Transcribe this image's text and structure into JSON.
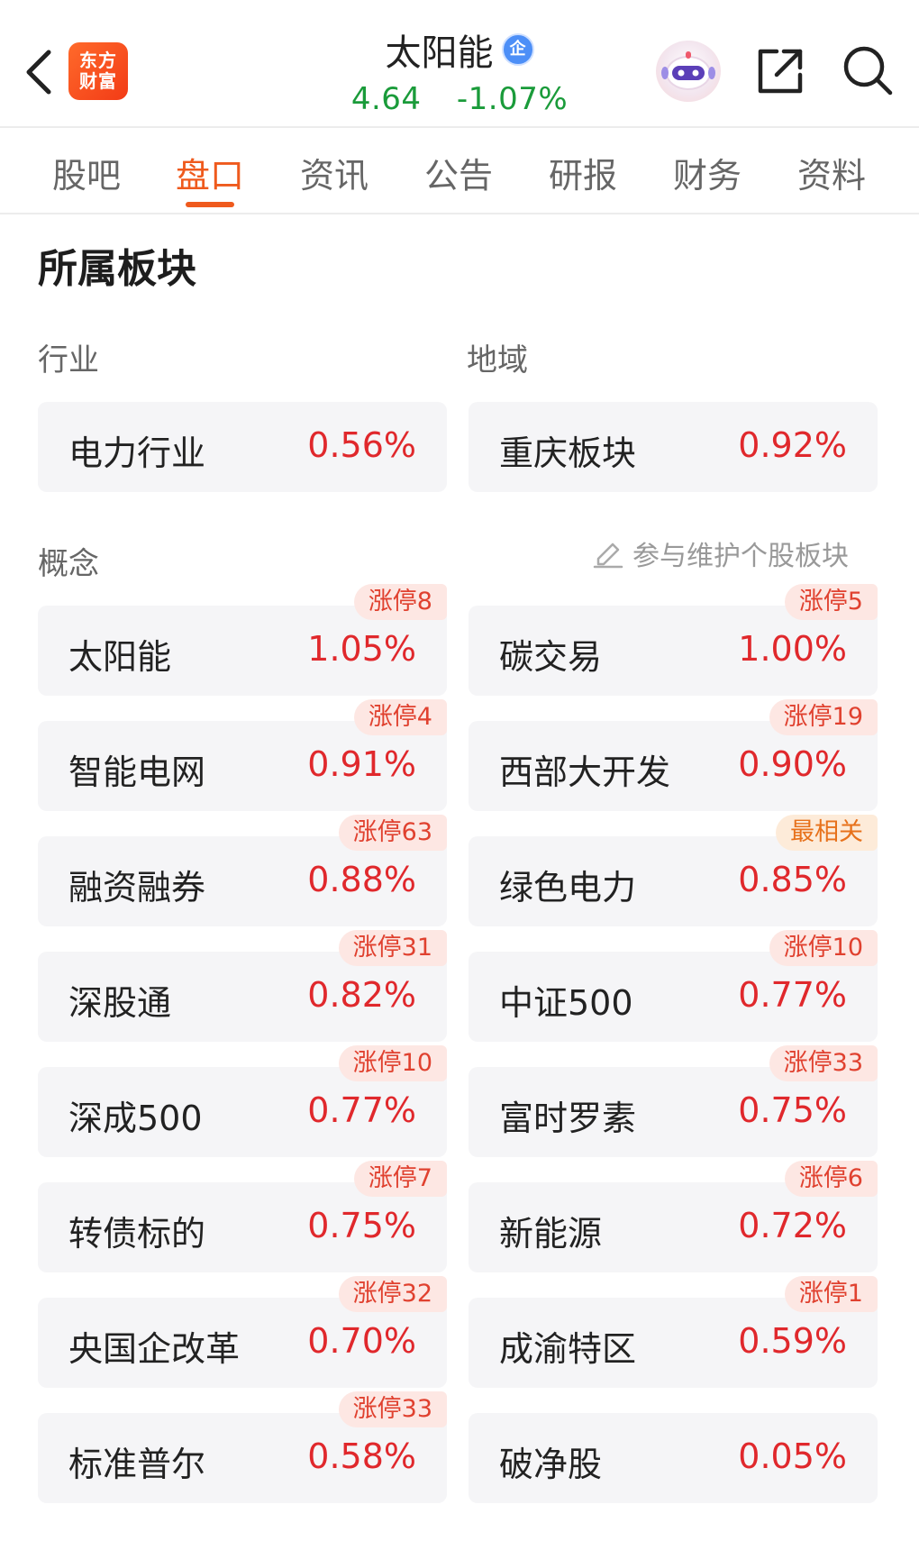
{
  "header": {
    "logo_line1": "东方",
    "logo_line2": "财富",
    "stock_name": "太阳能",
    "badge": "企",
    "price": "4.64",
    "change": "-1.07%"
  },
  "tabs": [
    {
      "label": "股吧"
    },
    {
      "label": "盘口"
    },
    {
      "label": "资讯"
    },
    {
      "label": "公告"
    },
    {
      "label": "研报"
    },
    {
      "label": "财务"
    },
    {
      "label": "资料"
    }
  ],
  "active_tab": "盘口",
  "section": {
    "title": "所属板块",
    "industry_label": "行业",
    "region_label": "地域",
    "concept_label": "概念",
    "maintain_link": "参与维护个股板块"
  },
  "industry": {
    "name": "电力行业",
    "pct": "0.56%"
  },
  "region": {
    "name": "重庆板块",
    "pct": "0.92%"
  },
  "concepts": [
    {
      "name": "太阳能",
      "pct": "1.05%",
      "tag": "涨停8"
    },
    {
      "name": "碳交易",
      "pct": "1.00%",
      "tag": "涨停5"
    },
    {
      "name": "智能电网",
      "pct": "0.91%",
      "tag": "涨停4"
    },
    {
      "name": "西部大开发",
      "pct": "0.90%",
      "tag": "涨停19"
    },
    {
      "name": "融资融券",
      "pct": "0.88%",
      "tag": "涨停63"
    },
    {
      "name": "绿色电力",
      "pct": "0.85%",
      "tag": "最相关"
    },
    {
      "name": "深股通",
      "pct": "0.82%",
      "tag": "涨停31"
    },
    {
      "name": "中证500",
      "pct": "0.77%",
      "tag": "涨停10"
    },
    {
      "name": "深成500",
      "pct": "0.77%",
      "tag": "涨停10"
    },
    {
      "name": "富时罗素",
      "pct": "0.75%",
      "tag": "涨停33"
    },
    {
      "name": "转债标的",
      "pct": "0.75%",
      "tag": "涨停7"
    },
    {
      "name": "新能源",
      "pct": "0.72%",
      "tag": "涨停6"
    },
    {
      "name": "央国企改革",
      "pct": "0.70%",
      "tag": "涨停32"
    },
    {
      "name": "成渝特区",
      "pct": "0.59%",
      "tag": "涨停1"
    },
    {
      "name": "标准普尔",
      "pct": "0.58%",
      "tag": "涨停33"
    },
    {
      "name": "破净股",
      "pct": "0.05%",
      "tag": ""
    }
  ],
  "colors": {
    "accent": "#ef5a1d",
    "rise": "#e0282c",
    "fall": "#1a9b3a",
    "tag_bg": "#fde7e3",
    "tag_orange": "#e7711b"
  },
  "icons": {
    "back": "chevron-left-icon",
    "robot": "robot-avatar-icon",
    "share": "share-external-icon",
    "search": "search-icon",
    "edit": "edit-pencil-icon"
  }
}
